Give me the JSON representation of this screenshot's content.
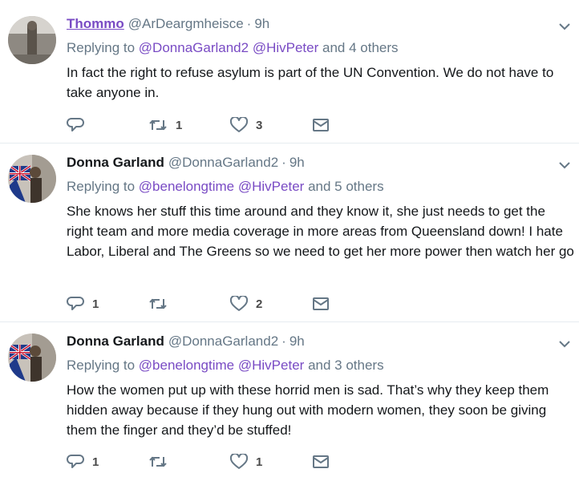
{
  "tweets": [
    {
      "name": "Thommo",
      "handle": "@ArDeargmheisce",
      "time": "9h",
      "replying_prefix": "Replying to",
      "reply_to_1": "@DonnaGarland2",
      "reply_to_2": "@HivPeter",
      "reply_others": "and 4 others",
      "body": "In fact the right to refuse asylum is part of the UN Convention. We do not have to take anyone in.",
      "reply_count": "",
      "retweet_count": "1",
      "like_count": "3"
    },
    {
      "name": "Donna Garland",
      "handle": "@DonnaGarland2",
      "time": "9h",
      "replying_prefix": "Replying to",
      "reply_to_1": "@benelongtime",
      "reply_to_2": "@HivPeter",
      "reply_others": "and 5 others",
      "body": "She knows her stuff this time around and they know it, she just needs to get the right team and more media coverage in more areas from Queensland down! I hate Labor, Liberal and The Greens so we need to get her more power then watch her go",
      "reply_count": "1",
      "retweet_count": "",
      "like_count": "2"
    },
    {
      "name": "Donna Garland",
      "handle": "@DonnaGarland2",
      "time": "9h",
      "replying_prefix": "Replying to",
      "reply_to_1": "@benelongtime",
      "reply_to_2": "@HivPeter",
      "reply_others": "and 3 others",
      "body": "How the women put up with these horrid men is sad. That’s why they keep them hidden away because if they hung out with modern women, they soon be giving them the finger and they’d be stuffed!",
      "reply_count": "1",
      "retweet_count": "",
      "like_count": "1"
    }
  ],
  "separator": "·",
  "colors": {
    "link": "#794bc4",
    "muted": "#657786",
    "divider": "#e6ecf0",
    "icon": "#657786"
  },
  "icons": [
    "reply-icon",
    "retweet-icon",
    "like-icon",
    "message-icon",
    "chevron-down-icon"
  ]
}
